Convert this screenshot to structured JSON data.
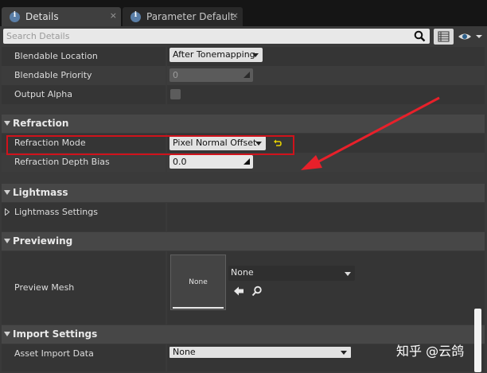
{
  "tabs": [
    {
      "label": "Details",
      "close": "×"
    },
    {
      "label": "Parameter Defaults",
      "close": "×"
    }
  ],
  "search": {
    "placeholder": "Search Details"
  },
  "rows_top": [
    {
      "label": "Blendable Location",
      "value": "After Tonemapping"
    },
    {
      "label": "Blendable Priority",
      "value": "0"
    },
    {
      "label": "Output Alpha"
    }
  ],
  "refraction": {
    "title": "Refraction",
    "mode_label": "Refraction Mode",
    "mode_value": "Pixel Normal Offset",
    "bias_label": "Refraction Depth Bias",
    "bias_value": "0.0"
  },
  "lightmass": {
    "title": "Lightmass",
    "settings_label": "Lightmass Settings"
  },
  "previewing": {
    "title": "Previewing",
    "mesh_label": "Preview Mesh",
    "thumb_text": "None",
    "mesh_value": "None"
  },
  "import_settings": {
    "title": "Import Settings",
    "asset_label": "Asset Import Data",
    "asset_value": "None"
  },
  "watermark": "知乎 @云鸽",
  "colors": {
    "highlight": "#d0121b",
    "arrow": "#e8202a"
  }
}
